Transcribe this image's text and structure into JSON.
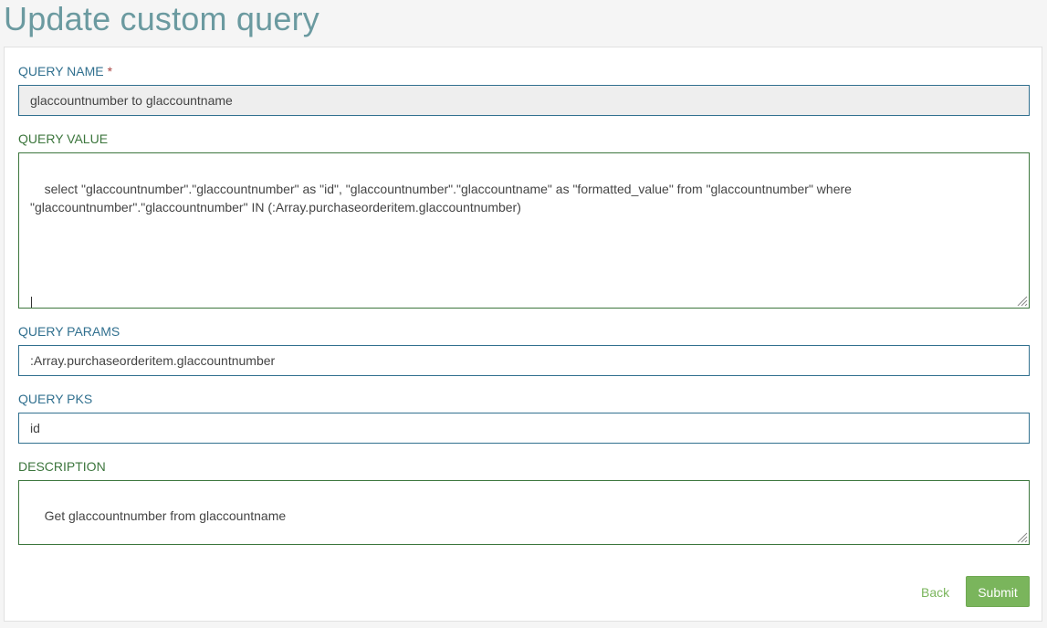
{
  "page": {
    "title": "Update custom query"
  },
  "form": {
    "query_name": {
      "label": "QUERY NAME",
      "required_marker": "*",
      "value": "glaccountnumber to glaccountname"
    },
    "query_value": {
      "label": "QUERY VALUE",
      "value": "select \"glaccountnumber\".\"glaccountnumber\" as \"id\", \"glaccountnumber\".\"glaccountname\" as \"formatted_value\" from \"glaccountnumber\" where \"glaccountnumber\".\"glaccountnumber\" IN (:Array.purchaseorderitem.glaccountnumber)"
    },
    "query_params": {
      "label": "QUERY PARAMS",
      "value": ":Array.purchaseorderitem.glaccountnumber"
    },
    "query_pks": {
      "label": "QUERY PKS",
      "value": "id"
    },
    "description": {
      "label": "DESCRIPTION",
      "value": "Get glaccountnumber from glaccountname"
    }
  },
  "actions": {
    "back_label": "Back",
    "submit_label": "Submit"
  },
  "colors": {
    "title": "#6b9aa0",
    "label_default": "#31708f",
    "label_success": "#3c763d",
    "accent": "#7ab55c"
  }
}
